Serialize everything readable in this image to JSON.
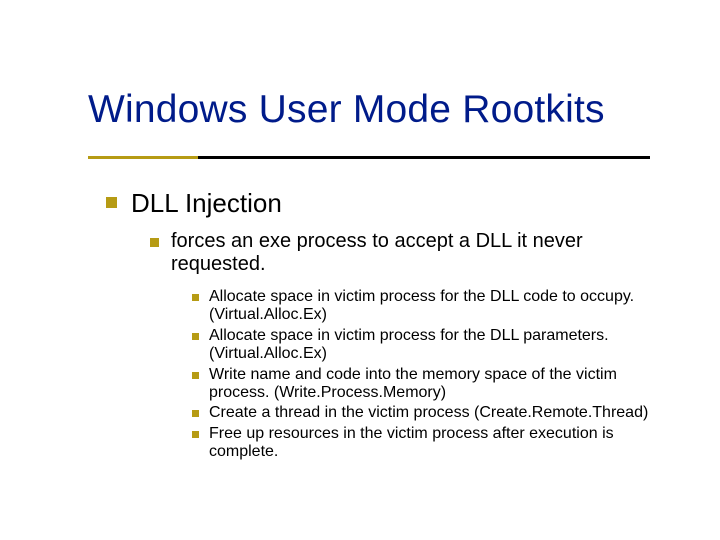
{
  "title": "Windows User Mode Rootkits",
  "lvl1": "DLL Injection",
  "lvl2": "forces an exe process to accept a DLL it never requested.",
  "lvl3": [
    "Allocate space in victim process for the DLL code to occupy. (Virtual.Alloc.Ex)",
    "Allocate space in victim process for the DLL parameters. (Virtual.Alloc.Ex)",
    "Write name and code into the memory space of the victim process.  (Write.Process.Memory)",
    "Create a thread in the victim process (Create.Remote.Thread)",
    "Free up resources in the victim process after execution is complete."
  ]
}
